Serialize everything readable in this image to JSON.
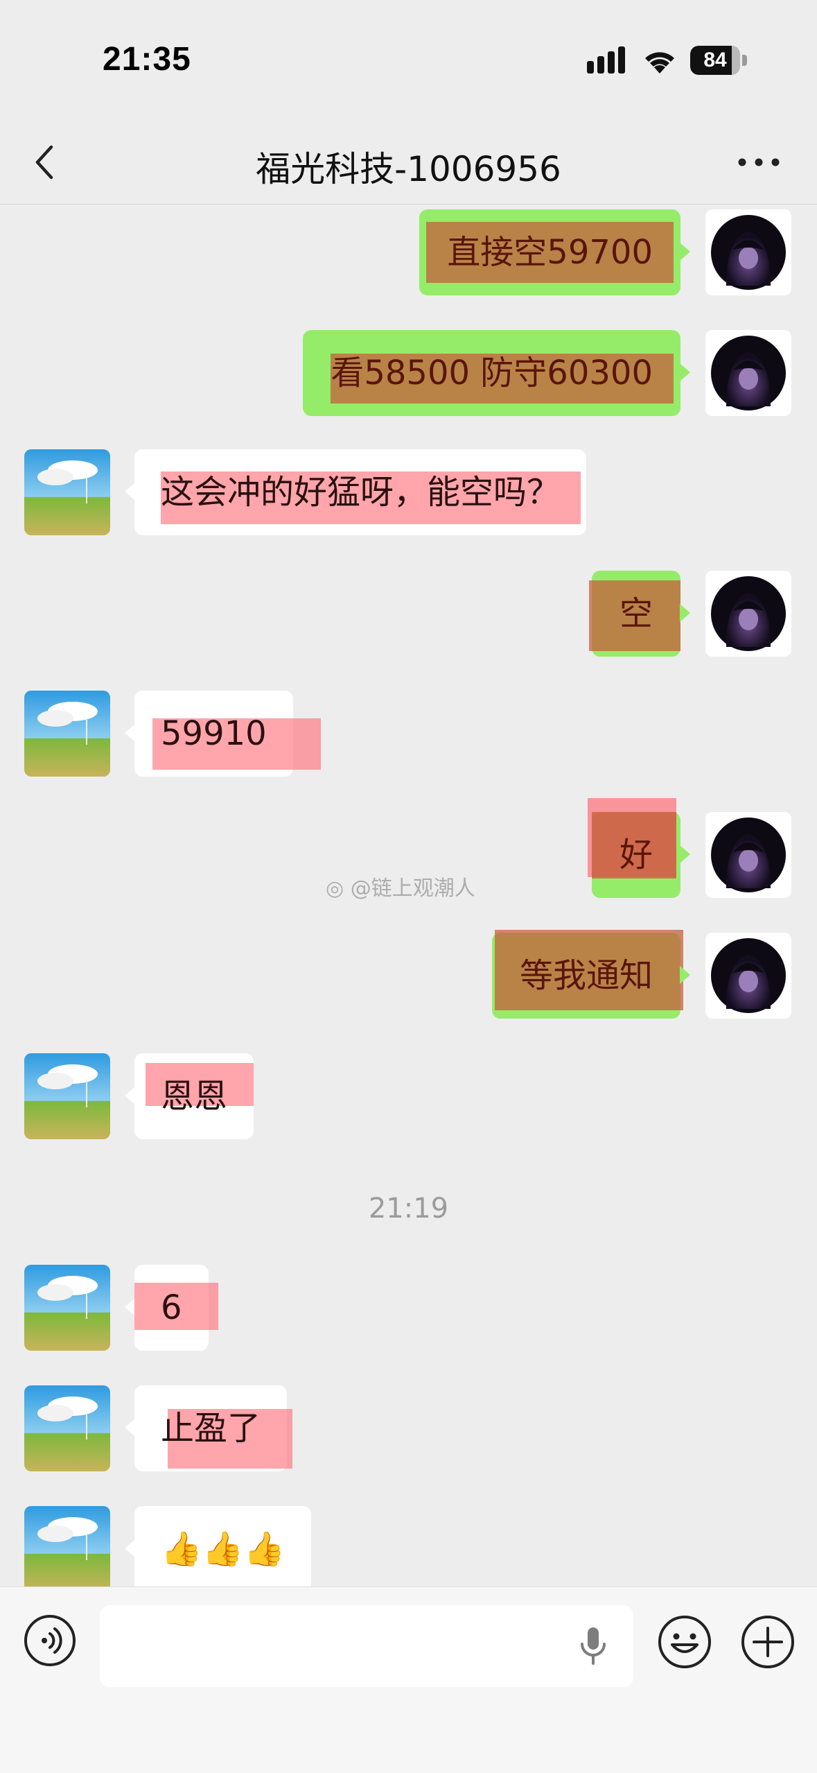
{
  "status_bar": {
    "time": "21:35",
    "battery": "84",
    "battery_level": 0.84
  },
  "nav": {
    "title": "福光科技-1006956"
  },
  "messages": [
    {
      "side": "out",
      "text": "直接空59700"
    },
    {
      "side": "out",
      "text": "看58500 防守60300"
    },
    {
      "side": "in",
      "text": "这会冲的好猛呀，能空吗？"
    },
    {
      "side": "out",
      "text": "空"
    },
    {
      "side": "in",
      "text": "59910"
    },
    {
      "side": "out",
      "text": "好"
    },
    {
      "side": "out",
      "text": "等我通知"
    },
    {
      "side": "in",
      "text": "恩恩"
    },
    {
      "side": "in",
      "text": "6"
    },
    {
      "side": "in",
      "text": "止盈了"
    },
    {
      "side": "in",
      "text": "👍👍👍"
    }
  ],
  "timestamp": "21:19",
  "watermark": "@链上观潮人",
  "icons": {
    "back": "chevron-left-icon",
    "more": "more-dots-icon",
    "voice": "voice-icon",
    "mic": "mic-icon",
    "emoji": "emoji-icon",
    "plus": "plus-icon"
  },
  "colors": {
    "outgoing_bubble": "#95ec69",
    "incoming_bubble": "#ffffff",
    "background": "#ededed"
  }
}
